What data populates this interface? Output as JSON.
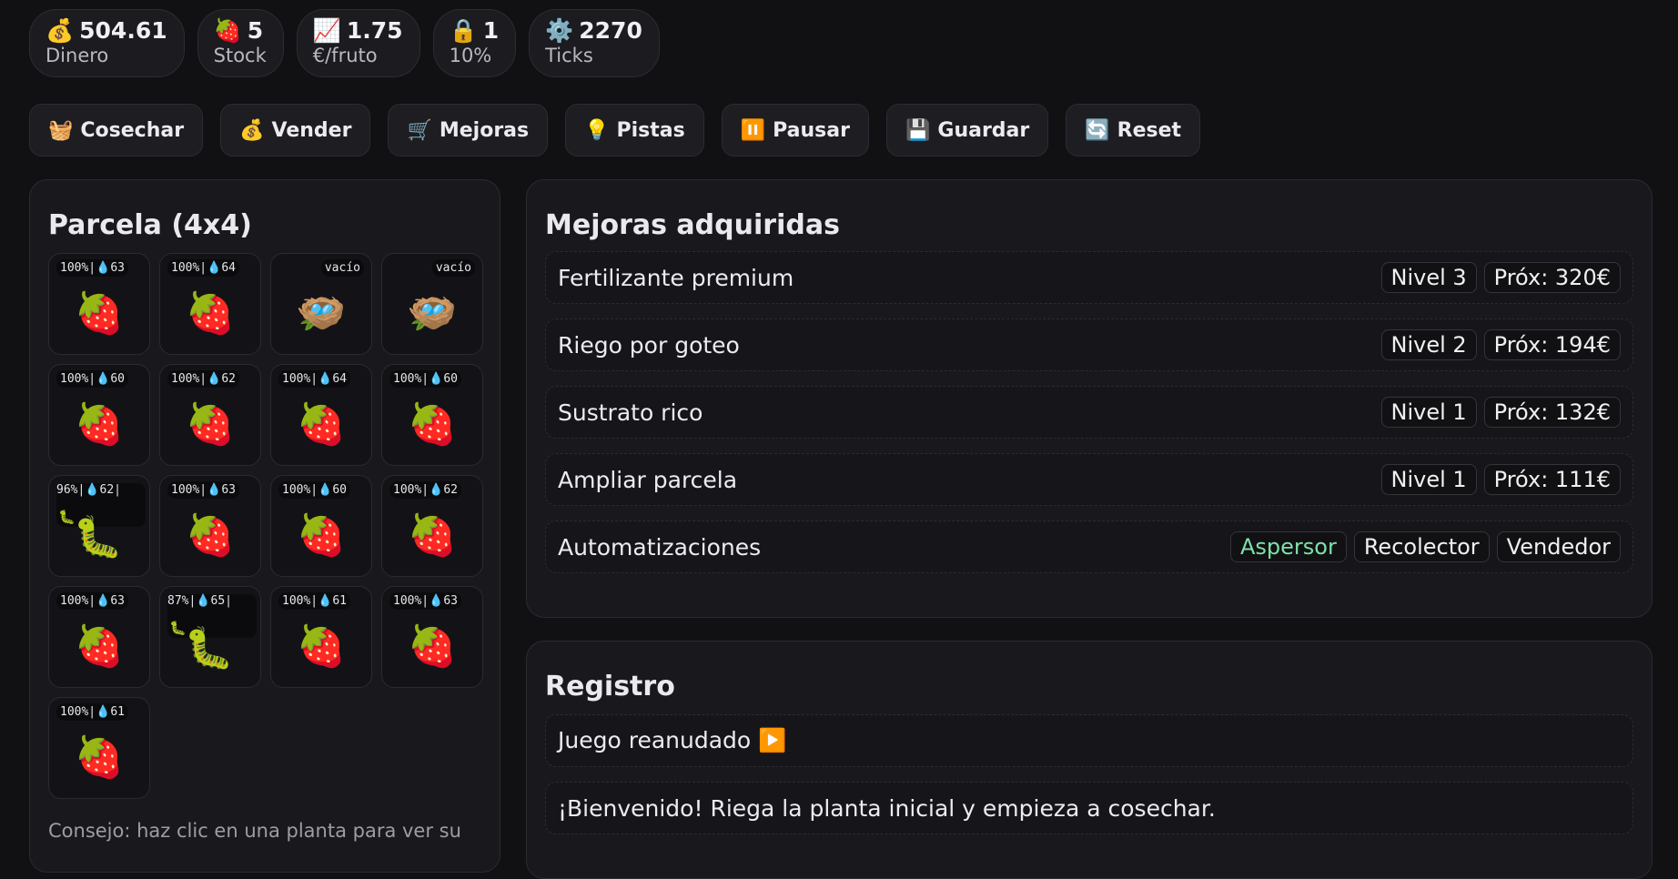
{
  "stats": [
    {
      "icon": "💰",
      "icon_name": "money-bag-icon",
      "value": "504.61",
      "label": "Dinero"
    },
    {
      "icon": "🍓",
      "icon_name": "strawberry-icon",
      "value": "5",
      "label": "Stock"
    },
    {
      "icon": "📈",
      "icon_name": "chart-up-icon",
      "value": "1.75",
      "label": "€/fruto"
    },
    {
      "icon": "🔒",
      "icon_name": "lock-icon",
      "value": "1",
      "label": "10%"
    },
    {
      "icon": "⚙️",
      "icon_name": "gear-icon",
      "value": "2270",
      "label": "Ticks"
    }
  ],
  "actions": [
    {
      "icon": "🧺",
      "icon_name": "basket-icon",
      "label": "Cosechar"
    },
    {
      "icon": "💰",
      "icon_name": "money-bag-icon",
      "label": "Vender"
    },
    {
      "icon": "🛒",
      "icon_name": "cart-icon",
      "label": "Mejoras"
    },
    {
      "icon": "💡",
      "icon_name": "lightbulb-icon",
      "label": "Pistas"
    },
    {
      "icon": "⏸️",
      "icon_name": "pause-icon",
      "label": "Pausar"
    },
    {
      "icon": "💾",
      "icon_name": "floppy-disk-icon",
      "label": "Guardar"
    },
    {
      "icon": "🔄",
      "icon_name": "refresh-icon",
      "label": "Reset"
    }
  ],
  "parcela": {
    "title": "Parcela (4x4)",
    "tip": "Consejo: haz clic en una planta para ver su",
    "cells": [
      {
        "label": "100%|💧63",
        "type": "strawberry"
      },
      {
        "label": "100%|💧64",
        "type": "strawberry"
      },
      {
        "label": "vacío",
        "type": "empty"
      },
      {
        "label": "vacío",
        "type": "empty"
      },
      {
        "label": "100%|💧60",
        "type": "strawberry"
      },
      {
        "label": "100%|💧62",
        "type": "strawberry"
      },
      {
        "label": "100%|💧64",
        "type": "strawberry"
      },
      {
        "label": "100%|💧60",
        "type": "strawberry"
      },
      {
        "label": "96%|💧62|",
        "type": "bug"
      },
      {
        "label": "100%|💧63",
        "type": "strawberry"
      },
      {
        "label": "100%|💧60",
        "type": "strawberry"
      },
      {
        "label": "100%|💧62",
        "type": "strawberry"
      },
      {
        "label": "100%|💧63",
        "type": "strawberry"
      },
      {
        "label": "87%|💧65|",
        "type": "bug"
      },
      {
        "label": "100%|💧61",
        "type": "strawberry"
      },
      {
        "label": "100%|💧63",
        "type": "strawberry"
      },
      {
        "label": "100%|💧61",
        "type": "strawberry"
      }
    ]
  },
  "mejoras": {
    "title": "Mejoras adquiridas",
    "items": [
      {
        "name": "Fertilizante premium",
        "badges": [
          {
            "text": "Nivel 3",
            "active": false
          },
          {
            "text": "Próx: 320€",
            "active": false
          }
        ]
      },
      {
        "name": "Riego por goteo",
        "badges": [
          {
            "text": "Nivel 2",
            "active": false
          },
          {
            "text": "Próx: 194€",
            "active": false
          }
        ]
      },
      {
        "name": "Sustrato rico",
        "badges": [
          {
            "text": "Nivel 1",
            "active": false
          },
          {
            "text": "Próx: 132€",
            "active": false
          }
        ]
      },
      {
        "name": "Ampliar parcela",
        "badges": [
          {
            "text": "Nivel 1",
            "active": false
          },
          {
            "text": "Próx: 111€",
            "active": false
          }
        ]
      },
      {
        "name": "Automatizaciones",
        "badges": [
          {
            "text": "Aspersor",
            "active": true
          },
          {
            "text": "Recolector",
            "active": false
          },
          {
            "text": "Vendedor",
            "active": false
          }
        ]
      }
    ]
  },
  "registro": {
    "title": "Registro",
    "entries": [
      "Juego reanudado ▶️",
      "¡Bienvenido! Riega la planta inicial y empieza a cosechar."
    ]
  },
  "colors": {
    "active_badge": "#7fe0a8",
    "background": "#111114",
    "panel": "#18181d"
  }
}
